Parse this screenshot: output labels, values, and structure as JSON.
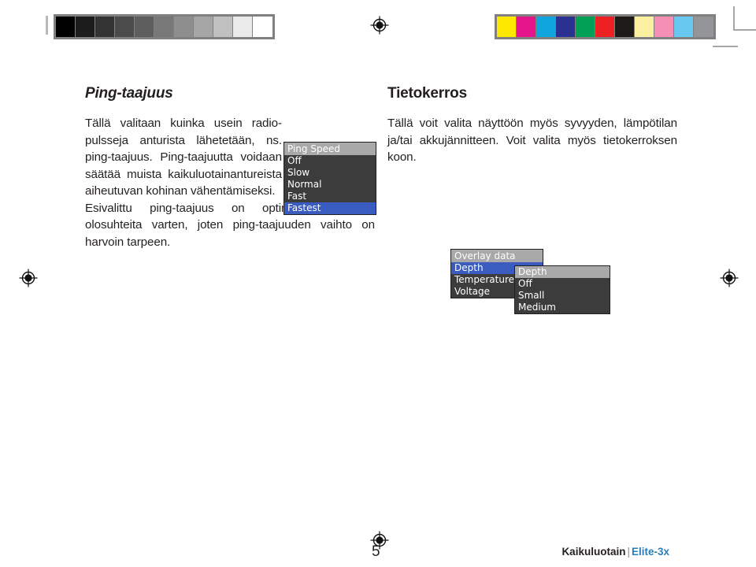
{
  "document": {
    "page_number": "5",
    "footer_product": "Kaikuluotain",
    "footer_separator": "|",
    "footer_model": "Elite-3x",
    "footer_model_color": "#2a7fb8"
  },
  "calibration": {
    "grayscale_label": "grayscale-calibration-bar",
    "grayscale_swatches": [
      "#000000",
      "#1c1c1c",
      "#333333",
      "#4b4b4b",
      "#5e5e5e",
      "#787878",
      "#8e8e8e",
      "#a6a6a6",
      "#c0c0c0",
      "#eaeaea",
      "#ffffff"
    ],
    "color_label": "color-calibration-bar",
    "color_swatches": [
      "#ffe800",
      "#e5158c",
      "#11a5e0",
      "#2b3190",
      "#00a057",
      "#ed2024",
      "#1e1a18",
      "#faf0a0",
      "#f58fb4",
      "#69c8f0",
      "#939598"
    ],
    "frame_color": "#808080"
  },
  "sections": [
    {
      "id": "ping-taajuus",
      "heading": "Ping-taajuus",
      "paragraphs": [
        "Tällä valitaan kuinka usein radio-pulsseja anturista lähetetään, ns. ping-taajuus. Ping-taajuutta voidaan säätää muista kaikuluotainantureista aiheutuvan kohinan vähentämiseksi.",
        "Esivalittu ping-taajuus on optimoitu useimpia olosuhteita varten, joten ping-taajuuden vaihto on harvoin tarpeen."
      ]
    },
    {
      "id": "tietokerros",
      "heading": "Tietokerros",
      "paragraphs": [
        "Tällä voit valita näyttöön myös syvyyden, lämpötilan ja/tai akkujännitteen. Voit valita myös tietokerroksen koon."
      ]
    }
  ],
  "widgets": {
    "ping_speed": {
      "title": "Ping Speed",
      "items": [
        {
          "label": "Off",
          "selected": false
        },
        {
          "label": "Slow",
          "selected": false
        },
        {
          "label": "Normal",
          "selected": false
        },
        {
          "label": "Fast",
          "selected": false
        },
        {
          "label": "Fastest",
          "selected": true
        }
      ],
      "selected_value": "Fastest",
      "title_bg": "#a9a9a9",
      "body_bg": "#3c3c3c",
      "highlight": "#3a5bbf"
    },
    "overlay_data": {
      "title": "Overlay data",
      "items": [
        {
          "label": "Depth",
          "selected": true
        },
        {
          "label": "Temperature",
          "selected": false
        },
        {
          "label": "Voltage",
          "selected": false
        }
      ],
      "selected_value": "Depth"
    },
    "overlay_size": {
      "title": "Depth",
      "items": [
        {
          "label": "Off",
          "selected": false
        },
        {
          "label": "Small",
          "selected": false
        },
        {
          "label": "Medium",
          "selected": false
        }
      ]
    }
  }
}
